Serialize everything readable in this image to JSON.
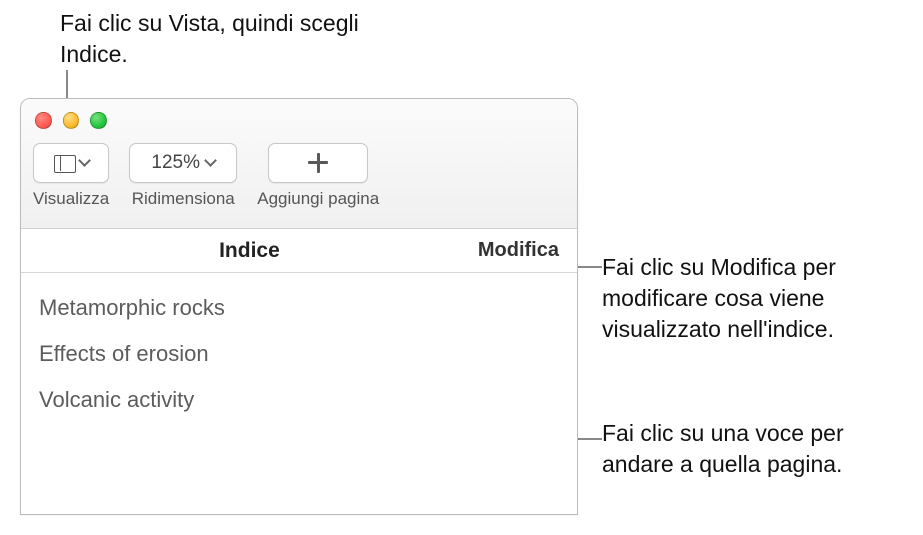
{
  "callouts": {
    "top": "Fai clic su Vista, quindi scegli Indice.",
    "right1": "Fai clic su Modifica per modificare cosa viene visualizzato nell'indice.",
    "right2": "Fai clic su una voce per andare a quella pagina."
  },
  "toolbar": {
    "view_label": "Visualizza",
    "zoom_value": "125%",
    "zoom_label": "Ridimensiona",
    "add_label": "Aggiungi pagina"
  },
  "toc": {
    "header_title": "Indice",
    "edit_label": "Modifica",
    "items": [
      {
        "label": "Metamorphic rocks"
      },
      {
        "label": "Effects of erosion"
      },
      {
        "label": "Volcanic activity"
      }
    ]
  }
}
